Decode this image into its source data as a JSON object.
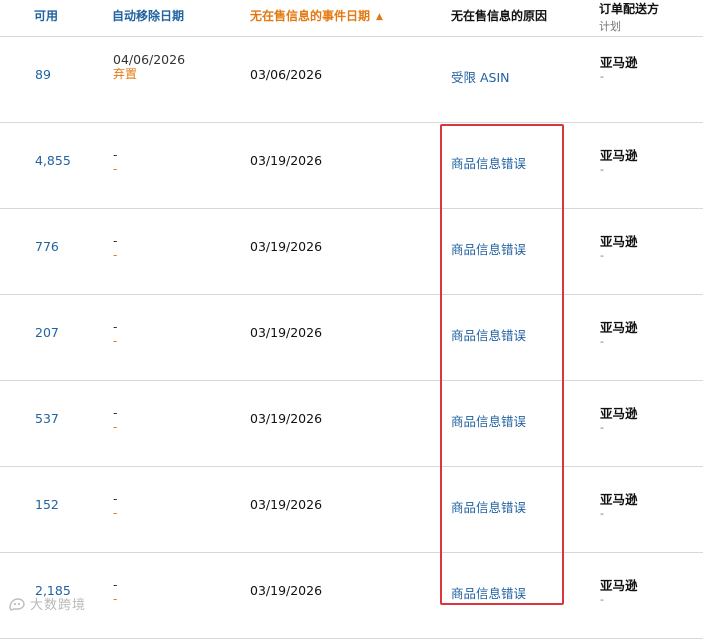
{
  "columns": {
    "available": "可用",
    "auto_removal_date": "自动移除日期",
    "event_date": "无在售信息的事件日期",
    "reason": "无在售信息的原因",
    "fulfillment": "订单配送方",
    "fulfillment_sub": "计划"
  },
  "rows": [
    {
      "available": "89",
      "auto_date": "04/06/2026",
      "auto_note": "弃置",
      "event_date": "03/06/2026",
      "reason": "受限 ASIN",
      "fulfillment": "亚马逊",
      "plan": "-"
    },
    {
      "available": "4,855",
      "auto_date": "-",
      "auto_note": "-",
      "event_date": "03/19/2026",
      "reason": "商品信息错误",
      "fulfillment": "亚马逊",
      "plan": "-"
    },
    {
      "available": "776",
      "auto_date": "-",
      "auto_note": "-",
      "event_date": "03/19/2026",
      "reason": "商品信息错误",
      "fulfillment": "亚马逊",
      "plan": "-"
    },
    {
      "available": "207",
      "auto_date": "-",
      "auto_note": "-",
      "event_date": "03/19/2026",
      "reason": "商品信息错误",
      "fulfillment": "亚马逊",
      "plan": "-"
    },
    {
      "available": "537",
      "auto_date": "-",
      "auto_note": "-",
      "event_date": "03/19/2026",
      "reason": "商品信息错误",
      "fulfillment": "亚马逊",
      "plan": "-"
    },
    {
      "available": "152",
      "auto_date": "-",
      "auto_note": "-",
      "event_date": "03/19/2026",
      "reason": "商品信息错误",
      "fulfillment": "亚马逊",
      "plan": "-"
    },
    {
      "available": "2,185",
      "auto_date": "-",
      "auto_note": "-",
      "event_date": "03/19/2026",
      "reason": "商品信息错误",
      "fulfillment": "亚马逊",
      "plan": "-"
    }
  ],
  "watermark": "大数跨境",
  "colors": {
    "link": "#2162a1",
    "sort_active": "#e47911",
    "highlight": "#d9363e",
    "divider": "#d5d9d9"
  },
  "sort": {
    "column": "event_date",
    "direction": "ascending",
    "icon": "sort-ascending-icon"
  }
}
